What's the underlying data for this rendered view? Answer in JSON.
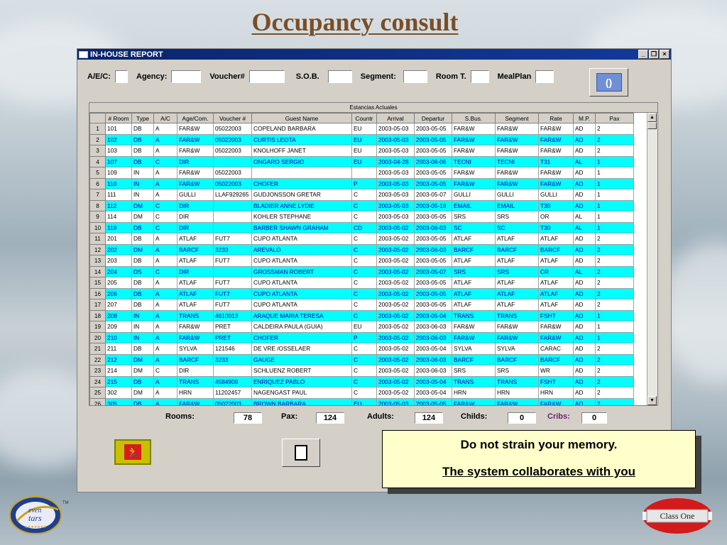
{
  "slide": {
    "title": "Occupancy consult"
  },
  "window": {
    "title": "IN-HOUSE REPORT",
    "controls": [
      "_",
      "❐",
      "×"
    ]
  },
  "filters": {
    "aec": "A/E/C:",
    "agency": "Agency:",
    "voucher": "Voucher#",
    "sob": "S.O.B.",
    "segment": "Segment:",
    "room_type": "Room T.",
    "meal_plan": "MealPlan",
    "refresh_icon": "refresh-icon",
    "refresh_glyph": "()"
  },
  "grid": {
    "caption": "Estancias Actuales",
    "columns": [
      "# Room",
      "Type",
      "A/C",
      "Age/Com.",
      "Voucher #",
      "Guest Name",
      "Countr",
      "Arrival",
      "Departur",
      "S.Bus.",
      "Segment",
      "Rate",
      "M.P.",
      "Pax"
    ],
    "rows": [
      {
        "n": "1",
        "cells": [
          "101",
          "DB",
          "A",
          "FAR&W",
          "05022003",
          "COPELAND BARBARA",
          "EU",
          "2003-05-03",
          "2003-05-05",
          "FAR&W",
          "FAR&W",
          "FAR&W",
          "AD",
          "2"
        ]
      },
      {
        "n": "2",
        "cells": [
          "102",
          "DB",
          "A",
          "FAR&W",
          "05022003",
          "CURTIS LEOTA",
          "EU",
          "2003-05-03",
          "2003-05-05",
          "FAR&W",
          "FAR&W",
          "FAR&W",
          "AD",
          "2"
        ]
      },
      {
        "n": "3",
        "cells": [
          "103",
          "DB",
          "A",
          "FAR&W",
          "05022003",
          "KNOLHOFF JANET",
          "EU",
          "2003-05-03",
          "2003-05-05",
          "FAR&W",
          "FAR&W",
          "FAR&W",
          "AD",
          "2"
        ]
      },
      {
        "n": "4",
        "cells": [
          "107",
          "DB",
          "C",
          "DIR",
          "",
          "ONGARO SERGIO",
          "EU",
          "2003-04-28",
          "2003-06-06",
          "TECNI",
          "TECNI",
          "T31",
          "AL",
          "1"
        ]
      },
      {
        "n": "5",
        "cells": [
          "109",
          "IN",
          "A",
          "FAR&W",
          "05022003",
          "",
          "",
          "2003-05-03",
          "2003-05-05",
          "FAR&W",
          "FAR&W",
          "FAR&W",
          "AD",
          "1"
        ]
      },
      {
        "n": "6",
        "cells": [
          "110",
          "IN",
          "A",
          "FAR&W",
          "05022003",
          "CHOFER",
          "P",
          "2003-05-03",
          "2003-05-05",
          "FAR&W",
          "FAR&W",
          "FAR&W",
          "AD",
          "1"
        ]
      },
      {
        "n": "7",
        "cells": [
          "111",
          "IN",
          "A",
          "GULLI",
          "LLAF929265",
          "GUDJONSSON GRETAR",
          "C",
          "2003-05-03",
          "2003-05-07",
          "GULLI",
          "GULLI",
          "GULLI",
          "AD",
          "1"
        ]
      },
      {
        "n": "8",
        "cells": [
          "112",
          "DM",
          "C",
          "DIR",
          "",
          "BLADIER ANNE LYDIE",
          "C",
          "2003-05-03",
          "2003-05-18",
          "EMAIL",
          "EMAIL",
          "T30",
          "AD",
          "1"
        ]
      },
      {
        "n": "9",
        "cells": [
          "114",
          "DM",
          "C",
          "DIR",
          "",
          "KOHLER STEPHANE",
          "C",
          "2003-05-03",
          "2003-05-05",
          "SRS",
          "SRS",
          "OR",
          "AL",
          "1"
        ]
      },
      {
        "n": "10",
        "cells": [
          "119",
          "DB",
          "C",
          "DIR",
          "",
          "BARBER SHAWN GRAHAM",
          "CD",
          "2003-05-02",
          "2003-06-03",
          "SC",
          "SC",
          "T30",
          "AL",
          "1"
        ]
      },
      {
        "n": "11",
        "cells": [
          "201",
          "DB",
          "A",
          "ATLAF",
          "FUT7",
          "CUPO ATLANTA",
          "C",
          "2003-05-02",
          "2003-05-05",
          "ATLAF",
          "ATLAF",
          "ATLAF",
          "AD",
          "2"
        ]
      },
      {
        "n": "12",
        "cells": [
          "202",
          "DM",
          "A",
          "BARCF",
          "3233",
          "AREVALO",
          "C",
          "2003-05-02",
          "2003-06-03",
          "BARCF",
          "BARCF",
          "BARCF",
          "AD",
          "2"
        ]
      },
      {
        "n": "13",
        "cells": [
          "203",
          "DB",
          "A",
          "ATLAF",
          "FUT7",
          "CUPO ATLANTA",
          "C",
          "2003-05-02",
          "2003-05-05",
          "ATLAF",
          "ATLAF",
          "ATLAF",
          "AD",
          "2"
        ]
      },
      {
        "n": "14",
        "cells": [
          "204",
          "DS",
          "C",
          "DIR",
          "",
          "GROSSMAN ROBERT",
          "C",
          "2003-05-02",
          "2003-05-07",
          "SRS",
          "SRS",
          "CR",
          "AL",
          "2"
        ]
      },
      {
        "n": "15",
        "cells": [
          "205",
          "DB",
          "A",
          "ATLAF",
          "FUT7",
          "CUPO ATLANTA",
          "C",
          "2003-05-02",
          "2003-05-05",
          "ATLAF",
          "ATLAF",
          "ATLAF",
          "AD",
          "2"
        ]
      },
      {
        "n": "16",
        "cells": [
          "206",
          "DB",
          "A",
          "ATLAF",
          "FUT7",
          "CUPO ATLANTA",
          "C",
          "2003-05-02",
          "2003-05-05",
          "ATLAF",
          "ATLAF",
          "ATLAF",
          "AD",
          "2"
        ]
      },
      {
        "n": "17",
        "cells": [
          "207",
          "DB",
          "A",
          "ATLAF",
          "FUT7",
          "CUPO ATLANTA",
          "C",
          "2003-05-02",
          "2003-05-05",
          "ATLAF",
          "ATLAF",
          "ATLAF",
          "AD",
          "2"
        ]
      },
      {
        "n": "18",
        "cells": [
          "208",
          "IN",
          "A",
          "TRANS",
          "4610013",
          "ARAQUE MARIA TERESA",
          "C",
          "2003-05-02",
          "2003-05-04",
          "TRANS",
          "TRANS",
          "FSHT",
          "AD",
          "1"
        ]
      },
      {
        "n": "19",
        "cells": [
          "209",
          "IN",
          "A",
          "FAR&W",
          "PRET",
          "CALDEIRA PAULA (GUIA)",
          "EU",
          "2003-05-02",
          "2003-06-03",
          "FAR&W",
          "FAR&W",
          "FAR&W",
          "AD",
          "1"
        ]
      },
      {
        "n": "20",
        "cells": [
          "210",
          "IN",
          "A",
          "FAR&W",
          "PRET",
          "CHOFER",
          "P",
          "2003-05-02",
          "2003-06-03",
          "FAR&W",
          "FAR&W",
          "FAR&W",
          "AD",
          "1"
        ]
      },
      {
        "n": "21",
        "cells": [
          "211",
          "DB",
          "A",
          "SYLVA",
          "121546",
          "DE VRE /OSSELAER",
          "C",
          "2003-05-02",
          "2003-05-04",
          "SYLVA",
          "SYLVA",
          "CARAC",
          "AD",
          "2"
        ]
      },
      {
        "n": "22",
        "cells": [
          "212",
          "DM",
          "A",
          "BARCF",
          "3233",
          "GAUGE",
          "C",
          "2003-05-02",
          "2003-06-03",
          "BARCF",
          "BARCF",
          "BARCF",
          "AD",
          "2"
        ]
      },
      {
        "n": "23",
        "cells": [
          "214",
          "DM",
          "C",
          "DIR",
          "",
          "SCHLUENZ ROBERT",
          "C",
          "2003-05-02",
          "2003-06-03",
          "SRS",
          "SRS",
          "WR",
          "AD",
          "2"
        ]
      },
      {
        "n": "24",
        "cells": [
          "215",
          "DB",
          "A",
          "TRANS",
          "4584909",
          "ENRIQUEZ PABLO",
          "C",
          "2003-05-02",
          "2003-05-04",
          "TRANS",
          "TRANS",
          "FSHT",
          "AD",
          "2"
        ]
      },
      {
        "n": "25",
        "cells": [
          "302",
          "DM",
          "A",
          "HRN",
          "11202457",
          "NAGENGAST PAUL",
          "C",
          "2003-05-02",
          "2003-05-04",
          "HRN",
          "HRN",
          "HRN",
          "AD",
          "2"
        ]
      },
      {
        "n": "26",
        "cells": [
          "305",
          "DB",
          "A",
          "FAR&W",
          "05022003",
          "BROWN BARBARA",
          "EU",
          "2003-05-03",
          "2003-05-05",
          "FAR&W",
          "FAR&W",
          "FAR&W",
          "AD",
          "2"
        ]
      }
    ]
  },
  "totals": {
    "rooms_label": "Rooms:",
    "rooms_value": "78",
    "pax_label": "Pax:",
    "pax_value": "124",
    "adults_label": "Adults:",
    "adults_value": "124",
    "childs_label": "Childs:",
    "childs_value": "0",
    "cribs_label": "Cribs:",
    "cribs_value": "0"
  },
  "callout": {
    "line1": "Do not strain your memory.",
    "line2": "The system collaborates with you"
  },
  "logos": {
    "left": "Seven Stars",
    "right": "Class One"
  },
  "colors": {
    "title": "#7a4e26",
    "row_highlight": "#00ffff",
    "titlebar": "#0a246a"
  }
}
